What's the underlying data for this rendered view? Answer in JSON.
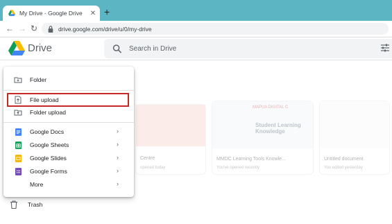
{
  "browser": {
    "tab_title": "My Drive - Google Drive",
    "url": "drive.google.com/drive/u/0/my-drive"
  },
  "drive": {
    "brand": "Drive",
    "search_placeholder": "Search in Drive"
  },
  "new_menu": {
    "items": [
      {
        "label": "Folder",
        "icon": "folder-plus-icon",
        "submenu": false
      },
      {
        "label": "File upload",
        "icon": "file-upload-icon",
        "submenu": false,
        "highlighted": true
      },
      {
        "label": "Folder upload",
        "icon": "folder-upload-icon",
        "submenu": false
      },
      {
        "label": "Google Docs",
        "icon": "docs-icon",
        "color": "#4285f4",
        "submenu": true
      },
      {
        "label": "Google Sheets",
        "icon": "sheets-icon",
        "color": "#0f9d58",
        "submenu": true
      },
      {
        "label": "Google Slides",
        "icon": "slides-icon",
        "color": "#f4b400",
        "submenu": true
      },
      {
        "label": "Google Forms",
        "icon": "forms-icon",
        "color": "#7248b9",
        "submenu": true
      },
      {
        "label": "More",
        "icon": "",
        "submenu": true
      }
    ]
  },
  "sidebar": {
    "trash_label": "Trash"
  },
  "background": {
    "cards": [
      {
        "title": "Centre",
        "subtitle": "opened today"
      },
      {
        "title": "MMDC Learning Tools Knowle...",
        "subtitle": "You've opened recently",
        "image_text": "Student Learning Knowledge",
        "image_brand": "MAPUA DIGITAL C"
      },
      {
        "title": "Untitled document",
        "subtitle": "You edited yesterday"
      }
    ]
  },
  "colors": {
    "tabbar": "#5bb5c3",
    "highlight_border": "#c62828"
  }
}
